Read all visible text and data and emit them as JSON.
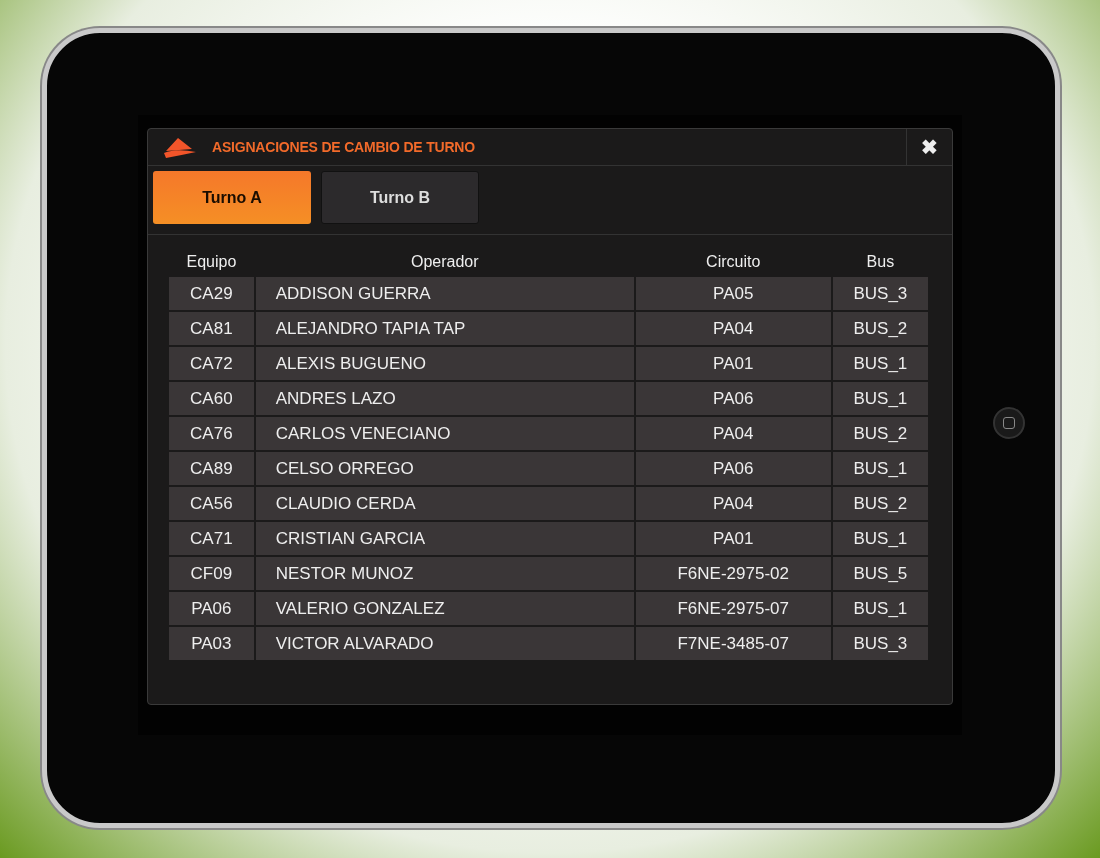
{
  "dialog": {
    "title": "ASIGNACIONES DE CAMBIO DE TURNO",
    "close": "✖"
  },
  "tabs": [
    {
      "label": "Turno A",
      "selected": true
    },
    {
      "label": "Turno B",
      "selected": false
    }
  ],
  "table": {
    "columns": [
      "Equipo",
      "Operador",
      "Circuito",
      "Bus"
    ],
    "rows": [
      [
        "CA29",
        "ADDISON GUERRA",
        "PA05",
        "BUS_3"
      ],
      [
        "CA81",
        "ALEJANDRO TAPIA TAP",
        "PA04",
        "BUS_2"
      ],
      [
        "CA72",
        "ALEXIS BUGUENO",
        "PA01",
        "BUS_1"
      ],
      [
        "CA60",
        "ANDRES LAZO",
        "PA06",
        "BUS_1"
      ],
      [
        "CA76",
        "CARLOS VENECIANO",
        "PA04",
        "BUS_2"
      ],
      [
        "CA89",
        "CELSO ORREGO",
        "PA06",
        "BUS_1"
      ],
      [
        "CA56",
        "CLAUDIO CERDA",
        "PA04",
        "BUS_2"
      ],
      [
        "CA71",
        "CRISTIAN GARCIA",
        "PA01",
        "BUS_1"
      ],
      [
        "CF09",
        "NESTOR MUNOZ",
        "F6NE-2975-02",
        "BUS_5"
      ],
      [
        "PA06",
        "VALERIO GONZALEZ",
        "F6NE-2975-07",
        "BUS_1"
      ],
      [
        "PA03",
        "VICTOR ALVARADO",
        "F7NE-3485-07",
        "BUS_3"
      ]
    ]
  }
}
